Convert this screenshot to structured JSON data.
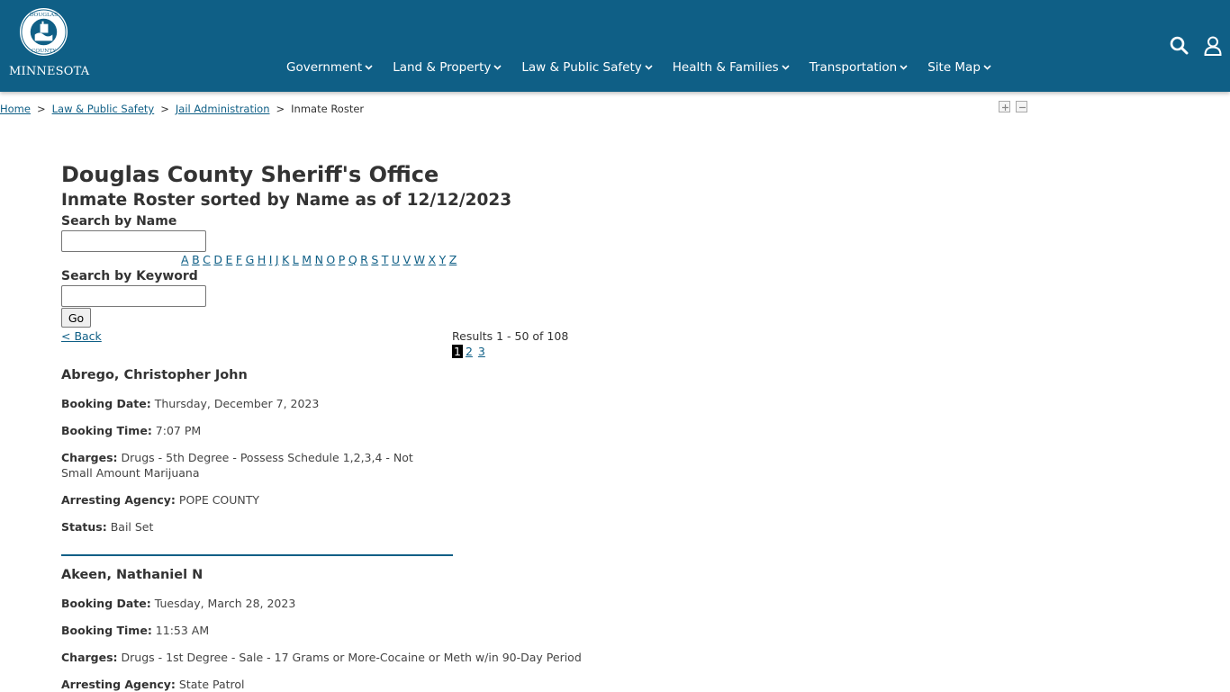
{
  "header": {
    "logo_text": "MINNESOTA",
    "seal_top": "DOUGLAS",
    "seal_bottom": "COUNTY",
    "nav": [
      {
        "label": "Government"
      },
      {
        "label": "Land & Property"
      },
      {
        "label": "Law & Public Safety"
      },
      {
        "label": "Health & Families"
      },
      {
        "label": "Transportation"
      },
      {
        "label": "Site Map"
      }
    ],
    "icons": [
      "search-icon",
      "user-icon"
    ],
    "colors": {
      "bar": "#0f5f86",
      "text": "#ffffff"
    }
  },
  "breadcrumb": {
    "items": [
      "Home",
      "Law & Public Safety",
      "Jail Administration"
    ],
    "current": "Inmate Roster",
    "separator": ">"
  },
  "page": {
    "title": "Douglas County Sheriff's Office",
    "subtitle": "Inmate Roster sorted by Name as of 12/12/2023",
    "search_name_label": "Search by Name",
    "search_name_value": "",
    "letters": [
      "A",
      "B",
      "C",
      "D",
      "E",
      "F",
      "G",
      "H",
      "I",
      "J",
      "K",
      "L",
      "M",
      "N",
      "O",
      "P",
      "Q",
      "R",
      "S",
      "T",
      "U",
      "V",
      "W",
      "X",
      "Y",
      "Z"
    ],
    "search_keyword_label": "Search by Keyword",
    "search_keyword_value": "",
    "go_label": "Go",
    "back_label": "< Back",
    "results_text": "Results 1 - 50 of 108",
    "pages": [
      "1",
      "2",
      "3"
    ],
    "current_page": "1"
  },
  "labels": {
    "booking_date": "Booking Date:",
    "booking_time": "Booking Time:",
    "charges": "Charges:",
    "arresting_agency": "Arresting Agency:",
    "status": "Status:"
  },
  "inmates": [
    {
      "name": "Abrego, Christopher John",
      "booking_date": "Thursday, December 7, 2023",
      "booking_time": "7:07 PM",
      "charges": "Drugs - 5th Degree - Possess Schedule 1,2,3,4 - Not Small Amount Marijuana",
      "arresting_agency": "POPE COUNTY",
      "status": "Bail Set"
    },
    {
      "name": "Akeen, Nathaniel N",
      "booking_date": "Tuesday, March 28, 2023",
      "booking_time": "11:53 AM",
      "charges": "Drugs - 1st Degree - Sale - 17 Grams or More-Cocaine or Meth w/in 90-Day Period",
      "arresting_agency": "State Patrol",
      "status": ""
    }
  ]
}
